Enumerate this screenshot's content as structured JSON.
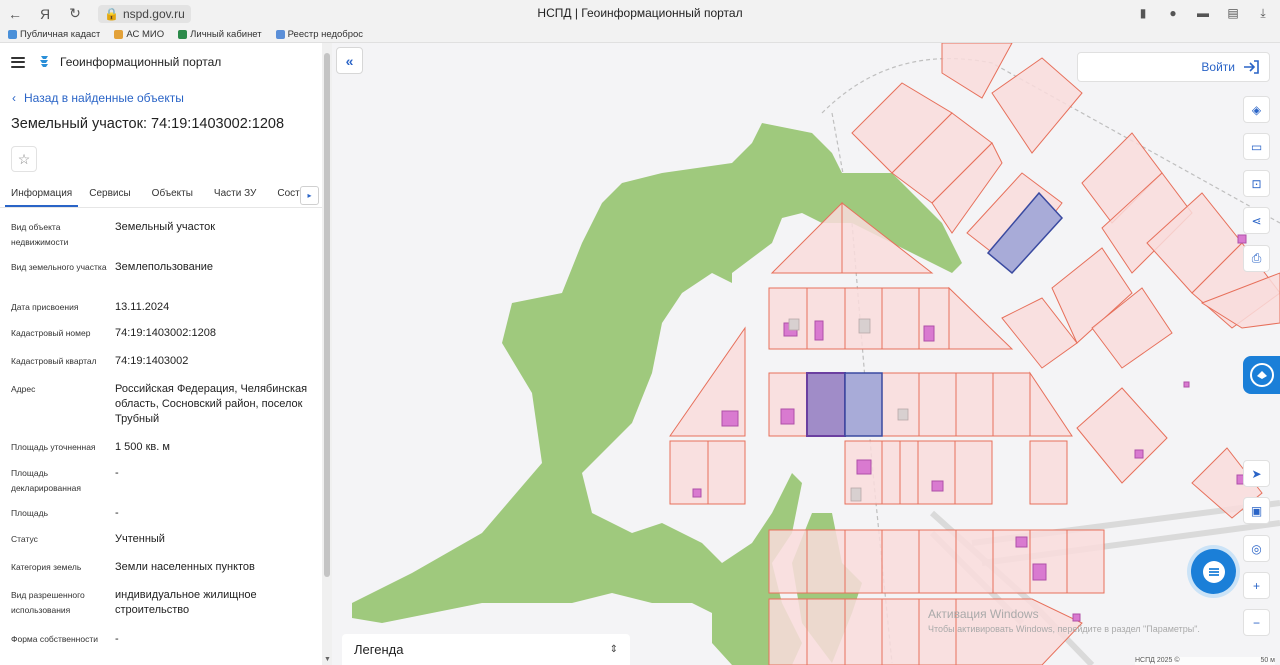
{
  "browser": {
    "url": "nspd.gov.ru",
    "tab_title": "НСПД | Геоинформационный портал",
    "bookmarks": [
      "Публичная кадаст",
      "АС МИО",
      "Личный кабинет",
      "Реестр недоброс"
    ]
  },
  "panel": {
    "portal_name": "Геоинформационный портал",
    "back_label": "Назад в найденные объекты",
    "title": "Земельный участок: 74:19:1403002:1208",
    "tabs": [
      "Информация",
      "Сервисы",
      "Объекты",
      "Части ЗУ",
      "Соста"
    ],
    "properties": [
      {
        "label": "Вид объекта недвижимости",
        "value": "Земельный участок"
      },
      {
        "label": "Вид земельного участка",
        "value": "Землепользование"
      },
      {
        "label": "Дата присвоения",
        "value": "13.11.2024"
      },
      {
        "label": "Кадастровый номер",
        "value": "74:19:1403002:1208"
      },
      {
        "label": "Кадастровый квартал",
        "value": "74:19:1403002"
      },
      {
        "label": "Адрес",
        "value": "Российская Федерация, Челябинская область, Сосновский район, поселок Трубный"
      },
      {
        "label": "Площадь уточненная",
        "value": "1 500 кв. м"
      },
      {
        "label": "Площадь декларированная",
        "value": "-"
      },
      {
        "label": "Площадь",
        "value": "-"
      },
      {
        "label": "Статус",
        "value": "Учтенный"
      },
      {
        "label": "Категория земель",
        "value": "Земли населенных пунктов"
      },
      {
        "label": "Вид разрешенного использования",
        "value": "индивидуальное жилищное строительство"
      },
      {
        "label": "Форма собственности",
        "value": "-"
      }
    ]
  },
  "map": {
    "login_label": "Войти",
    "legend_label": "Легенда",
    "watermark_title": "Активация Windows",
    "watermark_text": "Чтобы активировать Windows, перейдите в раздел \"Параметры\".",
    "scale_left": "НСПД 2025 ©",
    "scale_right": "50 м",
    "colors": {
      "parcel_fill": "#f9dcdc",
      "parcel_stroke": "#e7705b",
      "forest": "#9fc97d",
      "selected_fill": "#a8abd8",
      "selected_stroke": "#3a4aa0",
      "building": "#d97ad0",
      "accent": "#2a64c7"
    }
  }
}
